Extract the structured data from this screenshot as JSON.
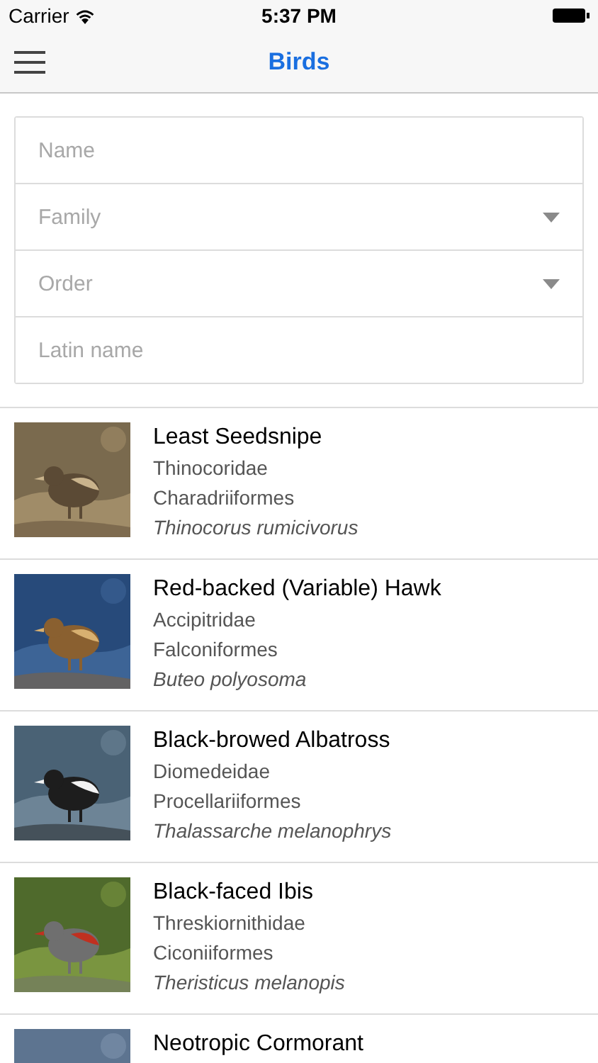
{
  "status_bar": {
    "carrier": "Carrier",
    "time": "5:37 PM"
  },
  "nav": {
    "title": "Birds"
  },
  "filters": [
    {
      "kind": "text",
      "placeholder": "Name"
    },
    {
      "kind": "select",
      "placeholder": "Family"
    },
    {
      "kind": "select",
      "placeholder": "Order"
    },
    {
      "kind": "text",
      "placeholder": "Latin name"
    }
  ],
  "birds": [
    {
      "name": "Least Seedsnipe",
      "family": "Thinocoridae",
      "order": "Charadriiformes",
      "latin": "Thinocorus rumicivorus"
    },
    {
      "name": "Red-backed (Variable) Hawk",
      "family": "Accipitridae",
      "order": "Falconiformes",
      "latin": "Buteo polyosoma"
    },
    {
      "name": "Black-browed Albatross",
      "family": "Diomedeidae",
      "order": "Procellariiformes",
      "latin": "Thalassarche melanophrys"
    },
    {
      "name": "Black-faced Ibis",
      "family": "Threskiornithidae",
      "order": "Ciconiiformes",
      "latin": "Theristicus melanopis"
    },
    {
      "name": "Neotropic Cormorant"
    }
  ]
}
